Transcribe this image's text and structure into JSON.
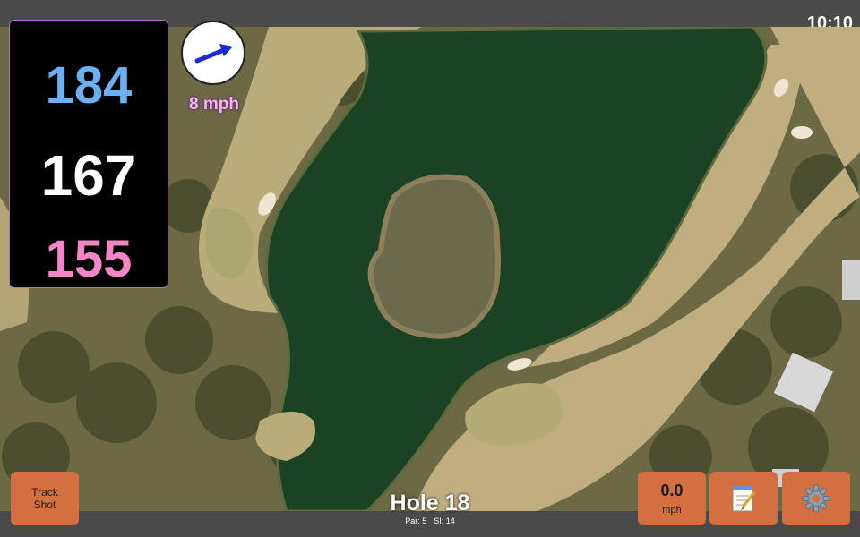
{
  "status": {
    "time": "10:10"
  },
  "yardages": {
    "back": "184",
    "middle": "167",
    "front": "155"
  },
  "wind": {
    "speed": "8 mph",
    "arrow_icon": "wind-direction-arrow-icon"
  },
  "hole": {
    "title": "Hole 18",
    "par": "Par: 5",
    "si": "SI: 14"
  },
  "buttons": {
    "track_shot": "Track Shot",
    "speed_value": "0.0",
    "speed_unit": "mph",
    "notes_icon": "notepad-icon",
    "settings_icon": "gear-icon"
  },
  "colors": {
    "back": "#6ab0f3",
    "middle": "#ffffff",
    "front": "#f486c8",
    "button": "#d4703f",
    "bar": "#4a4a4a"
  }
}
